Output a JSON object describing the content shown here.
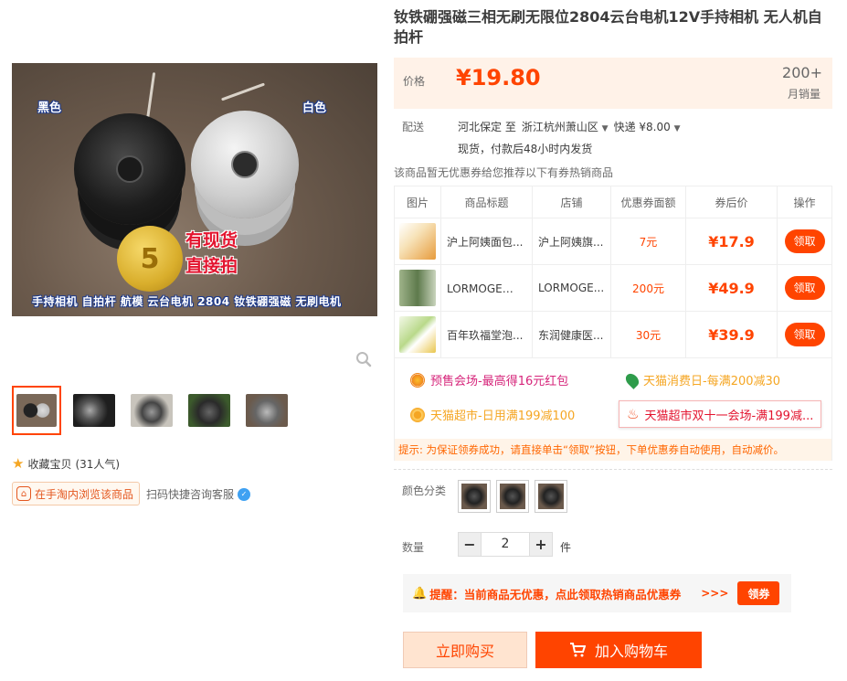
{
  "product": {
    "title": "钕铁硼强磁三相无刷无限位2804云台电机12V手持相机 无人机自拍杆"
  },
  "gallery": {
    "main_image": {
      "label_black": "黑色",
      "label_white": "白色",
      "promo_line1": "有现货",
      "promo_line2": "直接拍",
      "caption": "手持相机  自拍杆  航模  云台电机  2804  钕铁硼强磁  无刷电机",
      "coin_mark": "5"
    },
    "zoom_icon": "magnifier-icon",
    "thumbnails_count": 5
  },
  "favorite": {
    "icon": "star-icon",
    "label": "收藏宝贝",
    "count": "(31人气)"
  },
  "mobile": {
    "label": "在手淘内浏览该商品",
    "qr_text": "扫码快捷咨询客服"
  },
  "price": {
    "label": "价格",
    "value": "¥19.80",
    "sold_count": "200+",
    "sold_label": "月销量"
  },
  "shipping": {
    "label": "配送",
    "from": "河北保定 至",
    "to": "浙江杭州萧山区",
    "method": "快递 ¥8.00",
    "note": "现货，付款后48小时内发货"
  },
  "no_coupon_text": "该商品暂无优惠券给您推荐以下有券热销商品",
  "coupon_table": {
    "headers": [
      "图片",
      "商品标题",
      "店铺",
      "优惠券面额",
      "券后价",
      "操作"
    ],
    "rows": [
      {
        "title": "沪上阿姨面包...",
        "shop": "沪上阿姨旗...",
        "amount": "7元",
        "after": "¥17.9",
        "action": "领取"
      },
      {
        "title": "LORMOGE修...",
        "shop": "LORMOGE...",
        "amount": "200元",
        "after": "¥49.9",
        "action": "领取"
      },
      {
        "title": "百年玖福堂泡...",
        "shop": "东润健康医...",
        "amount": "30元",
        "after": "¥39.9",
        "action": "领取"
      }
    ]
  },
  "promos": [
    {
      "text": "预售会场-最高得16元红包",
      "color": "#d6247a",
      "icon": "sun-icon"
    },
    {
      "text": "天猫消费日-每满200减30",
      "color": "#f5a623",
      "icon": "leaf-icon"
    },
    {
      "text": "天猫超市-日用满199减100",
      "color": "#f5a623",
      "icon": "flower-icon"
    },
    {
      "text": "天猫超市双十一会场-满199减...",
      "color": "#e3142f",
      "icon": "fire-icon"
    }
  ],
  "tip": "提示: 为保证领券成功，请直接单击“领取”按钮，下单优惠券自动使用，自动减价。",
  "sku": {
    "color_label": "颜色分类",
    "qty_label": "数量",
    "qty_value": "2",
    "qty_unit": "件",
    "minus": "−",
    "plus": "+"
  },
  "reminder": {
    "text": "提醒：当前商品无优惠，点此领取热销商品优惠券",
    "arrows": ">>>",
    "button": "领券"
  },
  "actions": {
    "buy_now": "立即购买",
    "add_cart": "加入购物车"
  },
  "colors": {
    "accent": "#ff4400",
    "price_bg": "#fff2e8"
  }
}
